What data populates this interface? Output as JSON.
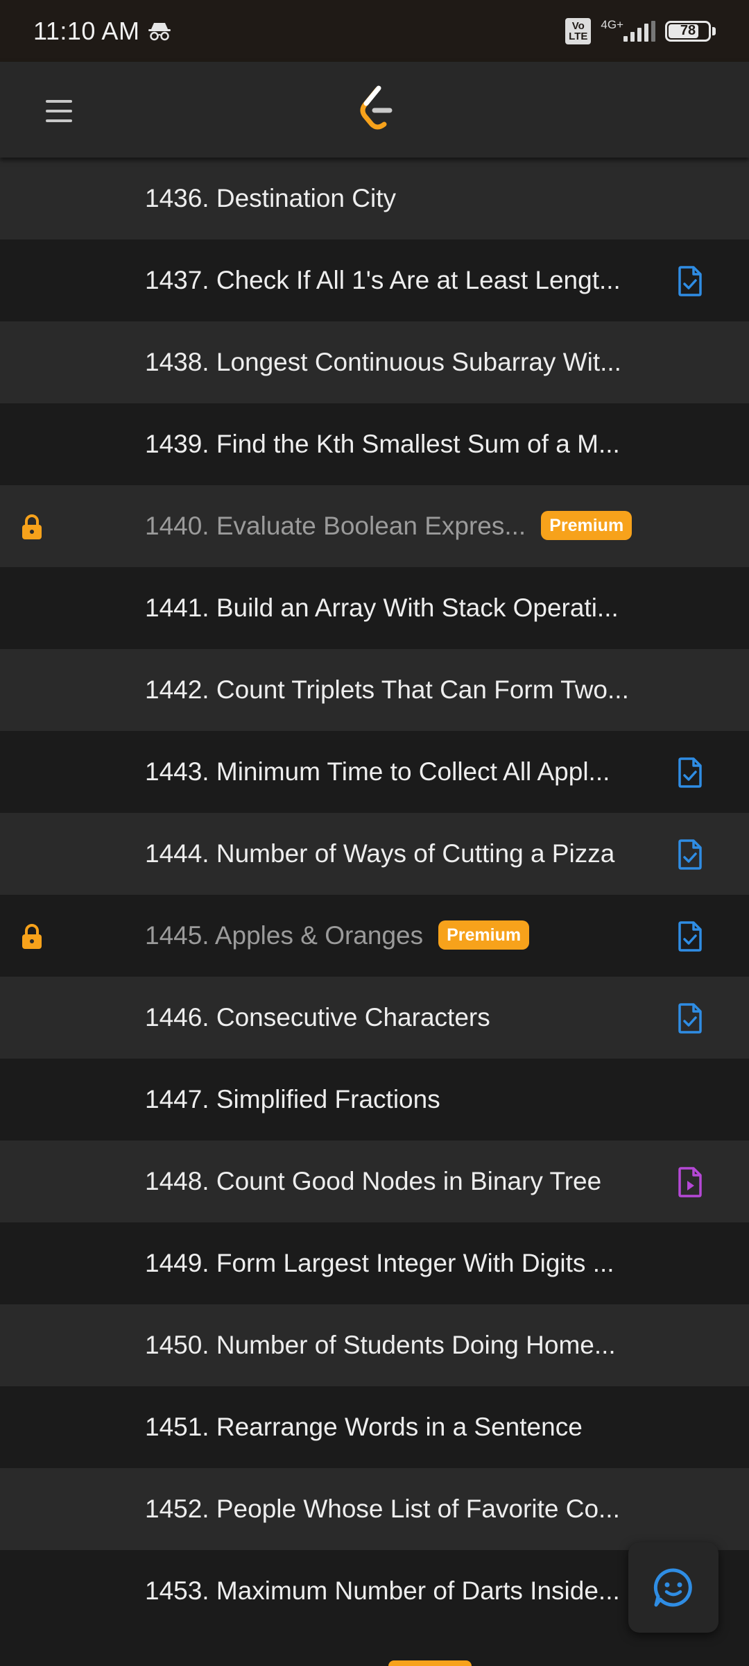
{
  "status_bar": {
    "time": "11:10 AM",
    "volte": "Vo LTE",
    "network_type": "4G+",
    "signal_bars": 4,
    "battery_level": "78",
    "battery_fraction": 0.78
  },
  "app_bar": {
    "menu_icon": "hamburger-menu-icon",
    "logo": "leetcode-logo"
  },
  "colors": {
    "accent": "#f7a21b",
    "solved_icon": "#2f8de4",
    "video_icon": "#b548d6",
    "row_light": "#2a2a2a",
    "row_dark": "#1b1b1b"
  },
  "problems": [
    {
      "title": "1436. Destination City",
      "locked": false,
      "premium": "",
      "status": "none"
    },
    {
      "title": "1437. Check If All 1's Are at Least Lengt...",
      "locked": false,
      "premium": "",
      "status": "solved"
    },
    {
      "title": "1438. Longest Continuous Subarray Wit...",
      "locked": false,
      "premium": "",
      "status": "none"
    },
    {
      "title": "1439. Find the Kth Smallest Sum of a M...",
      "locked": false,
      "premium": "",
      "status": "none"
    },
    {
      "title": "1440. Evaluate Boolean Expres...",
      "locked": true,
      "premium": "Premium",
      "status": "none"
    },
    {
      "title": "1441. Build an Array With Stack Operati...",
      "locked": false,
      "premium": "",
      "status": "none"
    },
    {
      "title": "1442. Count Triplets That Can Form Two...",
      "locked": false,
      "premium": "",
      "status": "none"
    },
    {
      "title": "1443. Minimum Time to Collect All Appl...",
      "locked": false,
      "premium": "",
      "status": "solved"
    },
    {
      "title": "1444. Number of Ways of Cutting a Pizza",
      "locked": false,
      "premium": "",
      "status": "solved"
    },
    {
      "title": "1445. Apples & Oranges",
      "locked": true,
      "premium": "Premium",
      "status": "solved"
    },
    {
      "title": "1446. Consecutive Characters",
      "locked": false,
      "premium": "",
      "status": "solved"
    },
    {
      "title": "1447. Simplified Fractions",
      "locked": false,
      "premium": "",
      "status": "none"
    },
    {
      "title": "1448. Count Good Nodes in Binary Tree",
      "locked": false,
      "premium": "",
      "status": "video"
    },
    {
      "title": "1449. Form Largest Integer With Digits ...",
      "locked": false,
      "premium": "",
      "status": "none"
    },
    {
      "title": "1450. Number of Students Doing Home...",
      "locked": false,
      "premium": "",
      "status": "none"
    },
    {
      "title": "1451. Rearrange Words in a Sentence",
      "locked": false,
      "premium": "",
      "status": "none"
    },
    {
      "title": "1452. People Whose List of Favorite Co...",
      "locked": false,
      "premium": "",
      "status": "none"
    },
    {
      "title": "1453. Maximum Number of Darts Inside...",
      "locked": false,
      "premium": "",
      "status": "none"
    }
  ],
  "fab": {
    "icon": "chat-feedback-icon"
  }
}
